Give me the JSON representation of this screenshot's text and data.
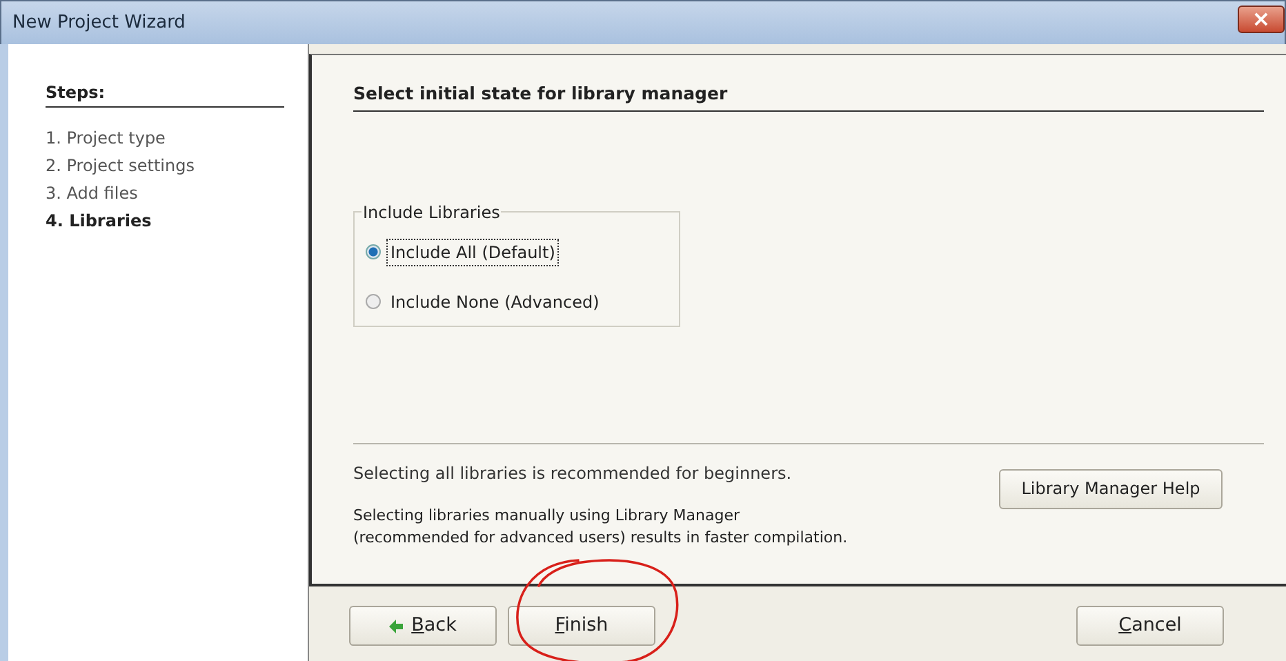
{
  "window": {
    "title": "New Project Wizard",
    "close": "×"
  },
  "steps": {
    "title": "Steps:",
    "items": [
      {
        "label": "1. Project type",
        "selected": false
      },
      {
        "label": "2. Project settings",
        "selected": false
      },
      {
        "label": "3. Add files",
        "selected": false
      },
      {
        "label": "4. Libraries",
        "selected": true
      }
    ]
  },
  "panel": {
    "heading": "Select initial state for library manager",
    "group": {
      "legend": "Include Libraries",
      "options": [
        {
          "label": "Include All (Default)",
          "selected": true,
          "focused": true
        },
        {
          "label": "Include None (Advanced)",
          "selected": false,
          "focused": false
        }
      ]
    },
    "note": "Selecting all libraries is recommended for beginners.",
    "detail": [
      "Selecting libraries manually using Library Manager",
      "(recommended for advanced users) results in faster compilation."
    ],
    "help_button": "Library Manager  Help"
  },
  "buttons": [
    {
      "kind": "back",
      "label": "Back",
      "underlined_initial": true
    },
    {
      "kind": "finish",
      "label": "Finish",
      "underlined_initial": true
    },
    {
      "kind": "cancel",
      "label": "Cancel",
      "underlined_initial": true
    }
  ]
}
